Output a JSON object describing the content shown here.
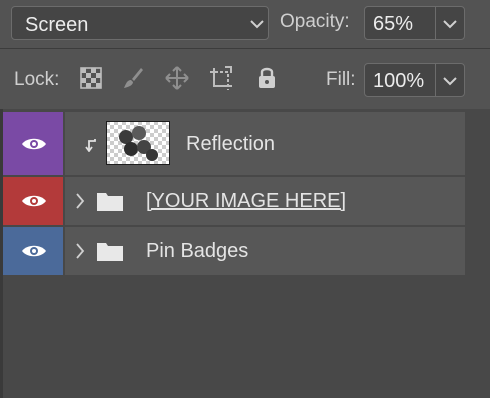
{
  "blend_mode": {
    "value": "Screen",
    "icon": "chevron-down-icon"
  },
  "opacity": {
    "label": "Opacity:",
    "value": "65%",
    "icon": "chevron-down-icon"
  },
  "lock": {
    "label": "Lock:",
    "icons": [
      "lock-transparent-pixels-icon",
      "lock-image-pixels-icon",
      "lock-position-icon",
      "lock-artboard-icon",
      "lock-all-icon"
    ]
  },
  "fill": {
    "label": "Fill:",
    "value": "100%",
    "icon": "chevron-down-icon"
  },
  "layers": [
    {
      "name": "Reflection",
      "visible": true,
      "color_tag": "#7a4aa5",
      "type": "clipped-layer",
      "icons": [
        "eye-icon",
        "clipping-arrow-icon",
        "layer-thumbnail"
      ]
    },
    {
      "name": "[YOUR IMAGE HERE]",
      "visible": true,
      "color_tag": "#b33a3a",
      "type": "group",
      "icons": [
        "eye-icon",
        "chevron-right-icon",
        "folder-icon"
      ]
    },
    {
      "name": "Pin Badges",
      "visible": true,
      "color_tag": "#4b6a9a",
      "type": "group",
      "icons": [
        "eye-icon",
        "chevron-right-icon",
        "folder-icon"
      ]
    }
  ],
  "colors": {
    "panel": "#535353",
    "field": "#454545",
    "layer_row": "#575757",
    "background": "#484848"
  }
}
